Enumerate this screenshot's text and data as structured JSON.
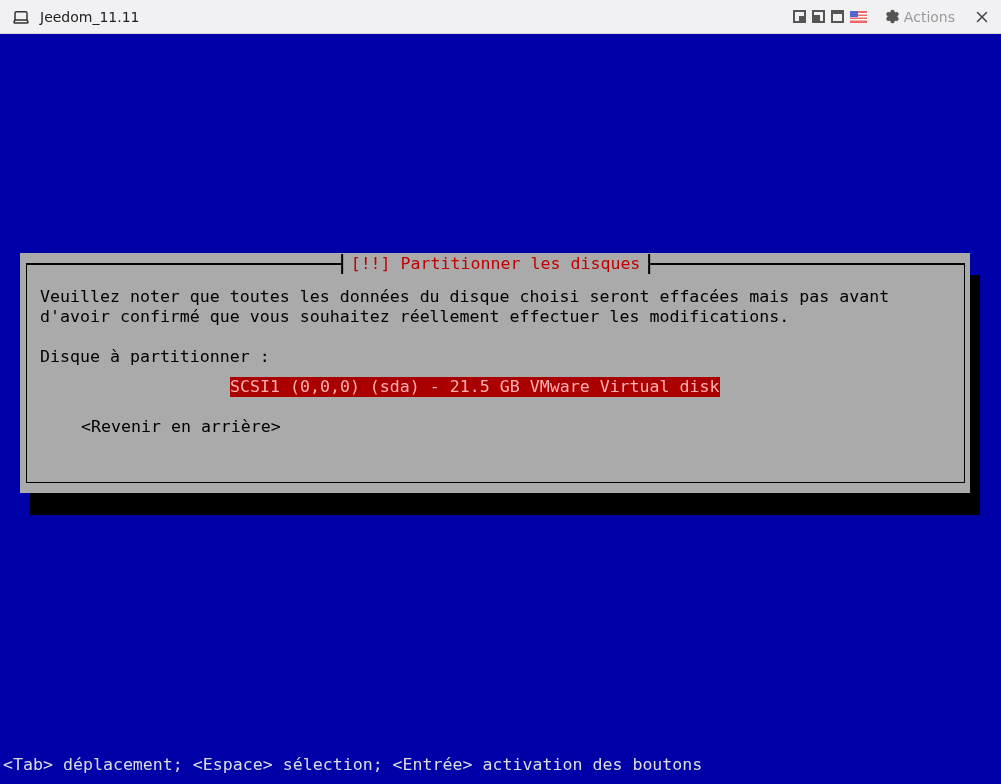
{
  "window": {
    "title": "Jeedom_11.11",
    "actions_label": "Actions"
  },
  "dialog": {
    "title": "[!!] Partitionner les disques",
    "message": "Veuillez noter que toutes les données du disque choisi seront effacées mais pas avant d'avoir confirmé que vous souhaitez réellement effectuer les modifications.",
    "prompt": "Disque à partitionner :",
    "options": [
      {
        "label": "SCSI1 (0,0,0) (sda) - 21.5 GB VMware Virtual disk",
        "selected": true
      }
    ],
    "back_button": "<Revenir en arrière>"
  },
  "status_bar": "<Tab> déplacement; <Espace> sélection; <Entrée> activation des boutons"
}
